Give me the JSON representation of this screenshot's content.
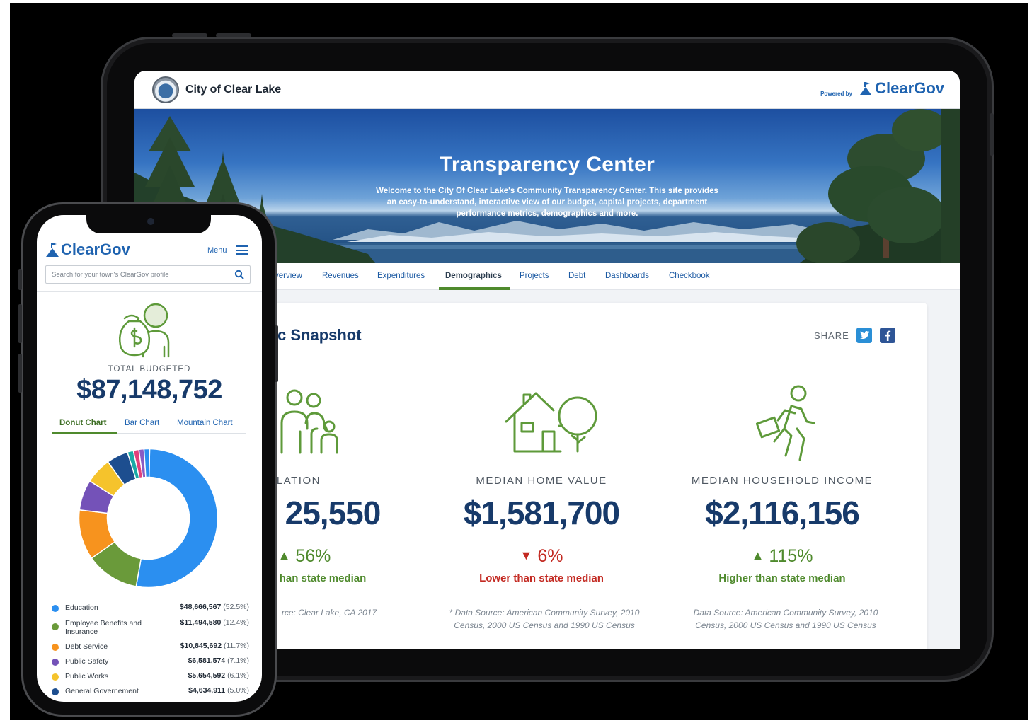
{
  "tablet": {
    "header": {
      "city_name": "City of Clear Lake",
      "powered_by": "Powered by",
      "brand": "ClearGov"
    },
    "hero": {
      "title": "Transparency Center",
      "subtitle": "Welcome to the City Of Clear Lake's Community Transparency Center. This site provides an easy-to-understand, interactive view of our budget, capital projects, department performance metrics, demographics and more."
    },
    "nav": {
      "items": [
        "verview",
        "Revenues",
        "Expenditures",
        "Demographics",
        "Projects",
        "Debt",
        "Dashboards",
        "Checkbook"
      ],
      "active": "Demographics"
    },
    "snapshot": {
      "title": "c Snapshot",
      "share_label": "SHARE"
    },
    "metrics": [
      {
        "label": "PULATION",
        "value": "25,550",
        "change": "56%",
        "direction": "up",
        "compare": "han state median",
        "source": "rce: Clear Lake, CA 2017"
      },
      {
        "label": "MEDIAN HOME VALUE",
        "value": "$1,581,700",
        "change": "6%",
        "direction": "down",
        "compare": "Lower than state median",
        "source": "* Data Source: American Community Survey, 2010 Census, 2000 US Census and 1990 US Census"
      },
      {
        "label": "MEDIAN HOUSEHOLD INCOME",
        "value": "$2,116,156",
        "change": "115%",
        "direction": "up",
        "compare": "Higher than state median",
        "source": "Data Source: American Community Survey, 2010 Census, 2000 US Census and 1990 US Census"
      }
    ]
  },
  "phone": {
    "brand": "ClearGov",
    "menu_label": "Menu",
    "search_placeholder": "Search for your town's ClearGov profile",
    "total_label": "TOTAL BUDGETED",
    "total_value": "$87,148,752",
    "tabs": [
      "Donut Chart",
      "Bar Chart",
      "Mountain Chart"
    ],
    "active_tab": "Donut Chart",
    "legend": [
      {
        "name": "Education",
        "value": "$48,666,567",
        "pct": "(52.5%)",
        "color": "#2b8ff0"
      },
      {
        "name": "Employee Benefits and Insurance",
        "value": "$11,494,580",
        "pct": "(12.4%)",
        "color": "#6a9a3a"
      },
      {
        "name": "Debt Service",
        "value": "$10,845,692",
        "pct": "(11.7%)",
        "color": "#f7931e"
      },
      {
        "name": "Public Safety",
        "value": "$6,581,574",
        "pct": "(7.1%)",
        "color": "#7452b8"
      },
      {
        "name": "Public Works",
        "value": "$5,654,592",
        "pct": "(6.1%)",
        "color": "#f5c32c"
      },
      {
        "name": "General Governement",
        "value": "$4,634,911",
        "pct": "(5.0%)",
        "color": "#1d4e8f"
      }
    ]
  },
  "chart_data": {
    "type": "pie",
    "categories": [
      "Education",
      "Employee Benefits and Insurance",
      "Debt Service",
      "Public Safety",
      "Public Works",
      "General Governement"
    ],
    "values": [
      52.5,
      12.4,
      11.7,
      7.1,
      6.1,
      5.0
    ],
    "extra_slice_colors": [
      "#1aa9a6",
      "#e0417a",
      "#8a5cc4",
      "#2b8ff0"
    ],
    "extra_slice_values": [
      1.4,
      1.3,
      1.2,
      1.3
    ]
  }
}
